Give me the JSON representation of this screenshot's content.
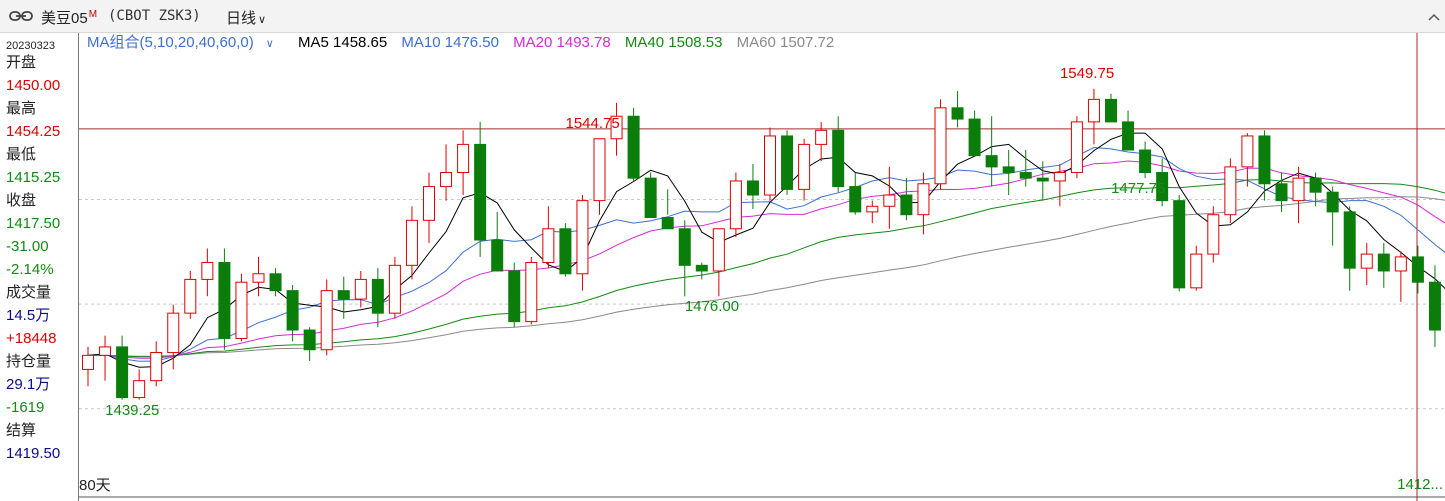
{
  "header": {
    "name": "美豆05",
    "badge": "M",
    "code": "(CBOT ZSK3)",
    "period": "日线"
  },
  "left_panel": {
    "date": "20230323",
    "rows": [
      {
        "label": "开盘",
        "value": "1450.00",
        "color": "#e00000"
      },
      {
        "label": "最高",
        "value": "1454.25",
        "color": "#e00000"
      },
      {
        "label": "最低",
        "value": "1415.25",
        "color": "#138a13"
      },
      {
        "label": "收盘",
        "value": "1417.50",
        "color": "#138a13"
      },
      {
        "label": null,
        "value": "-31.00",
        "color": "#138a13"
      },
      {
        "label": null,
        "value": "-2.14%",
        "color": "#138a13"
      },
      {
        "label": "成交量",
        "value": "14.5万",
        "color": "#0a0a8c"
      },
      {
        "label": null,
        "value": "+18448",
        "color": "#e00000"
      },
      {
        "label": "持仓量",
        "value": "29.1万",
        "color": "#0a0a8c"
      },
      {
        "label": null,
        "value": "-1619",
        "color": "#138a13"
      },
      {
        "label": "结算",
        "value": "1419.50",
        "color": "#0a0a8c"
      }
    ]
  },
  "legend": {
    "group": "MA组合(5,10,20,40,60,0)",
    "items": [
      {
        "label": "MA5 1458.65",
        "color": "#000000"
      },
      {
        "label": "MA10 1476.50",
        "color": "#3d6fd1"
      },
      {
        "label": "MA20 1493.78",
        "color": "#d62ad6"
      },
      {
        "label": "MA40 1508.53",
        "color": "#138a13"
      },
      {
        "label": "MA60 1507.72",
        "color": "#8a8a8a"
      }
    ]
  },
  "annotations": [
    {
      "text": "1544.75",
      "color": "#e00000",
      "candle": 30
    },
    {
      "text": "1549.75",
      "color": "#e00000",
      "candle": 59
    },
    {
      "text": "1476.00",
      "color": "#138a13",
      "candle": 37
    },
    {
      "text": "1477.75",
      "color": "#138a13",
      "candle": 62
    },
    {
      "text": "1439.25",
      "color": "#138a13",
      "candle": 3
    }
  ],
  "footer": {
    "range": "80天",
    "last": "1412..."
  },
  "colors": {
    "up": "#e00000",
    "down": "#0a7d0a",
    "crosshair": "#a52a2a"
  },
  "chart_data": {
    "type": "candlestick",
    "period": "日线",
    "visible_days": 80,
    "y_range": [
      1405,
      1560
    ],
    "crosshair_price": 1535.5,
    "candles": [
      [
        1450,
        1458,
        1444,
        1455
      ],
      [
        1455,
        1462,
        1446,
        1458
      ],
      [
        1458,
        1462,
        1439.25,
        1440
      ],
      [
        1440,
        1450,
        1439.25,
        1446
      ],
      [
        1446,
        1460,
        1444,
        1456
      ],
      [
        1456,
        1473,
        1450,
        1470
      ],
      [
        1470,
        1485,
        1468,
        1482
      ],
      [
        1482,
        1493,
        1476,
        1488
      ],
      [
        1488,
        1493,
        1457,
        1461
      ],
      [
        1461,
        1484,
        1460,
        1481
      ],
      [
        1481,
        1490,
        1476,
        1484
      ],
      [
        1484,
        1486,
        1476,
        1478
      ],
      [
        1478,
        1480,
        1460,
        1464
      ],
      [
        1464,
        1465,
        1453,
        1457
      ],
      [
        1457,
        1482,
        1455,
        1478
      ],
      [
        1478,
        1483,
        1468,
        1475
      ],
      [
        1475,
        1485,
        1472,
        1482
      ],
      [
        1482,
        1486,
        1465,
        1470
      ],
      [
        1470,
        1490,
        1468,
        1487
      ],
      [
        1487,
        1508,
        1482,
        1503
      ],
      [
        1503,
        1520,
        1495,
        1515
      ],
      [
        1515,
        1530,
        1510,
        1520
      ],
      [
        1520,
        1535,
        1512,
        1530
      ],
      [
        1530,
        1538,
        1490,
        1496
      ],
      [
        1496,
        1506,
        1485,
        1485
      ],
      [
        1485,
        1488,
        1465,
        1467
      ],
      [
        1467,
        1490,
        1466,
        1488
      ],
      [
        1488,
        1508,
        1486,
        1500
      ],
      [
        1500,
        1502,
        1483,
        1484
      ],
      [
        1484,
        1512,
        1478,
        1510
      ],
      [
        1510,
        1532,
        1505,
        1532
      ],
      [
        1532,
        1544.75,
        1526,
        1540
      ],
      [
        1540,
        1543,
        1517,
        1518
      ],
      [
        1518,
        1520,
        1505,
        1504
      ],
      [
        1504,
        1514,
        1505,
        1500
      ],
      [
        1500,
        1503,
        1476,
        1487
      ],
      [
        1487,
        1488,
        1482,
        1485
      ],
      [
        1485,
        1500,
        1476,
        1500
      ],
      [
        1500,
        1520,
        1497,
        1517
      ],
      [
        1517,
        1523,
        1507,
        1512
      ],
      [
        1512,
        1536,
        1510,
        1533
      ],
      [
        1533,
        1535,
        1512,
        1514
      ],
      [
        1514,
        1532,
        1510,
        1530
      ],
      [
        1530,
        1538,
        1524,
        1535
      ],
      [
        1535,
        1540,
        1513,
        1515
      ],
      [
        1515,
        1520,
        1505,
        1506
      ],
      [
        1506,
        1510,
        1502,
        1508
      ],
      [
        1508,
        1522,
        1500,
        1512
      ],
      [
        1512,
        1518,
        1503,
        1505
      ],
      [
        1505,
        1520,
        1498,
        1516
      ],
      [
        1516,
        1546,
        1514,
        1543
      ],
      [
        1543,
        1549,
        1536,
        1539
      ],
      [
        1539,
        1542,
        1528,
        1526
      ],
      [
        1526,
        1540,
        1515,
        1522
      ],
      [
        1522,
        1528,
        1512,
        1520
      ],
      [
        1520,
        1528,
        1515,
        1518
      ],
      [
        1518,
        1524,
        1510,
        1517
      ],
      [
        1517,
        1523,
        1508,
        1520
      ],
      [
        1520,
        1540,
        1518,
        1538
      ],
      [
        1538,
        1549.75,
        1530,
        1546
      ],
      [
        1546,
        1548,
        1538,
        1538
      ],
      [
        1538,
        1542,
        1528,
        1528
      ],
      [
        1528,
        1531,
        1518,
        1520
      ],
      [
        1520,
        1525,
        1508,
        1510
      ],
      [
        1510,
        1512,
        1477.75,
        1479
      ],
      [
        1479,
        1494,
        1478,
        1491
      ],
      [
        1491,
        1508,
        1488,
        1505
      ],
      [
        1505,
        1525,
        1502,
        1522
      ],
      [
        1522,
        1534,
        1515,
        1533
      ],
      [
        1533,
        1535,
        1510,
        1516
      ],
      [
        1516,
        1520,
        1506,
        1510
      ],
      [
        1510,
        1522,
        1502,
        1518
      ],
      [
        1518,
        1520,
        1508,
        1513
      ],
      [
        1513,
        1515,
        1494,
        1506
      ],
      [
        1506,
        1508,
        1478,
        1486
      ],
      [
        1486,
        1495,
        1480,
        1491
      ],
      [
        1491,
        1495,
        1479,
        1485
      ],
      [
        1485,
        1492,
        1474,
        1490
      ],
      [
        1490,
        1494,
        1477,
        1481
      ],
      [
        1481,
        1487,
        1458,
        1464
      ],
      [
        1464,
        1470,
        1448,
        1462
      ],
      [
        1462,
        1465,
        1436,
        1443
      ],
      [
        1443,
        1448,
        1415.25,
        1417.5
      ],
      [
        1417.5,
        1420,
        1412,
        1413
      ]
    ]
  }
}
